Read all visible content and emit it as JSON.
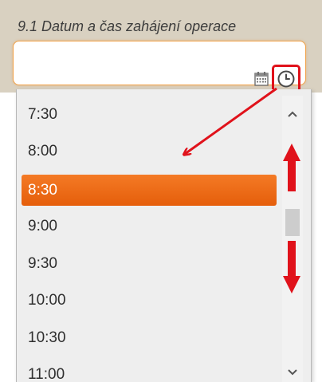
{
  "field": {
    "label": "9.1 Datum a čas zahájení operace",
    "value": ""
  },
  "time_list": {
    "options": [
      "7:30",
      "8:00",
      "8:30",
      "9:00",
      "9:30",
      "10:00",
      "10:30",
      "11:00"
    ],
    "selected": "8:30"
  },
  "icons": {
    "calendar": "calendar-icon",
    "clock": "clock-icon",
    "scroll_up": "chevron-up-icon",
    "scroll_down": "chevron-down-icon"
  },
  "colors": {
    "accent": "#e8650f",
    "annotation": "#e0121b",
    "field_border": "#f0a24a",
    "header_band": "#d9d1c1"
  }
}
